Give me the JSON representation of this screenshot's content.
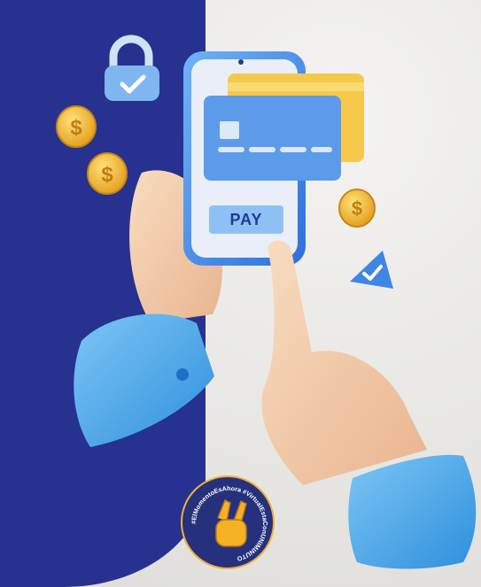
{
  "phone": {
    "button_label": "PAY"
  },
  "badge": {
    "text": "#ElMomentoEsAhora #VirtualEstaConUNIMINUTO"
  },
  "colors": {
    "panel": "#27318f",
    "card_blue": "#5b9bea",
    "card_yellow": "#f6c84a",
    "coin": "#f2b533",
    "sleeve": "#4aa6e8",
    "skin": "#f3cfae",
    "badge_ring": "#f0b03a"
  },
  "icons": [
    "lock-icon",
    "coin-icon",
    "check-icon",
    "peace-sign-icon"
  ]
}
